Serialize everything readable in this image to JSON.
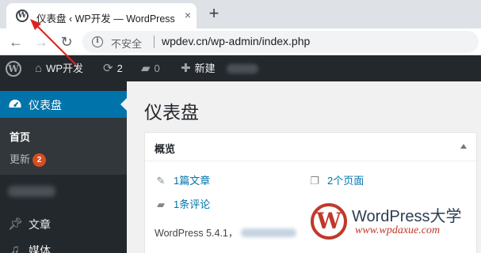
{
  "browser": {
    "tab_title": "仪表盘 ‹ WP开发 — WordPress",
    "tab_close": "×",
    "new_tab": "+",
    "nav_back": "←",
    "nav_forward": "→",
    "nav_reload": "↻",
    "security_label": "不安全",
    "url": "wpdev.cn/wp-admin/index.php"
  },
  "admin_bar": {
    "site_name": "WP开发",
    "updates_count": "2",
    "comments_count": "0",
    "new_label": "新建"
  },
  "sidebar": {
    "dashboard_label": "仪表盘",
    "home_label": "首页",
    "updates_label": "更新",
    "updates_badge": "2",
    "posts_label": "文章",
    "media_label": "媒体"
  },
  "main": {
    "page_title": "仪表盘",
    "glance": {
      "title": "概览",
      "posts": "1篇文章",
      "pages": "2个页面",
      "comments": "1条评论",
      "version": "WordPress 5.4.1，"
    }
  },
  "watermark": {
    "name": "WordPress大学",
    "url": "www.wpdaxue.com"
  },
  "colors": {
    "admin_bar_bg": "#23282d",
    "menu_active_bg": "#0073aa",
    "badge_bg": "#d54e21",
    "link": "#0073aa",
    "annotation_arrow": "#e02020"
  },
  "icons": {
    "favicon": "wordpress-icon",
    "admin_logo": "wordpress-logo-icon",
    "home": "home-icon",
    "updates": "refresh-icon",
    "comments": "comment-icon",
    "new": "plus-icon",
    "dashboard": "dashboard-gauge-icon",
    "posts": "pin-icon",
    "media": "media-icon",
    "pages": "pages-icon"
  }
}
